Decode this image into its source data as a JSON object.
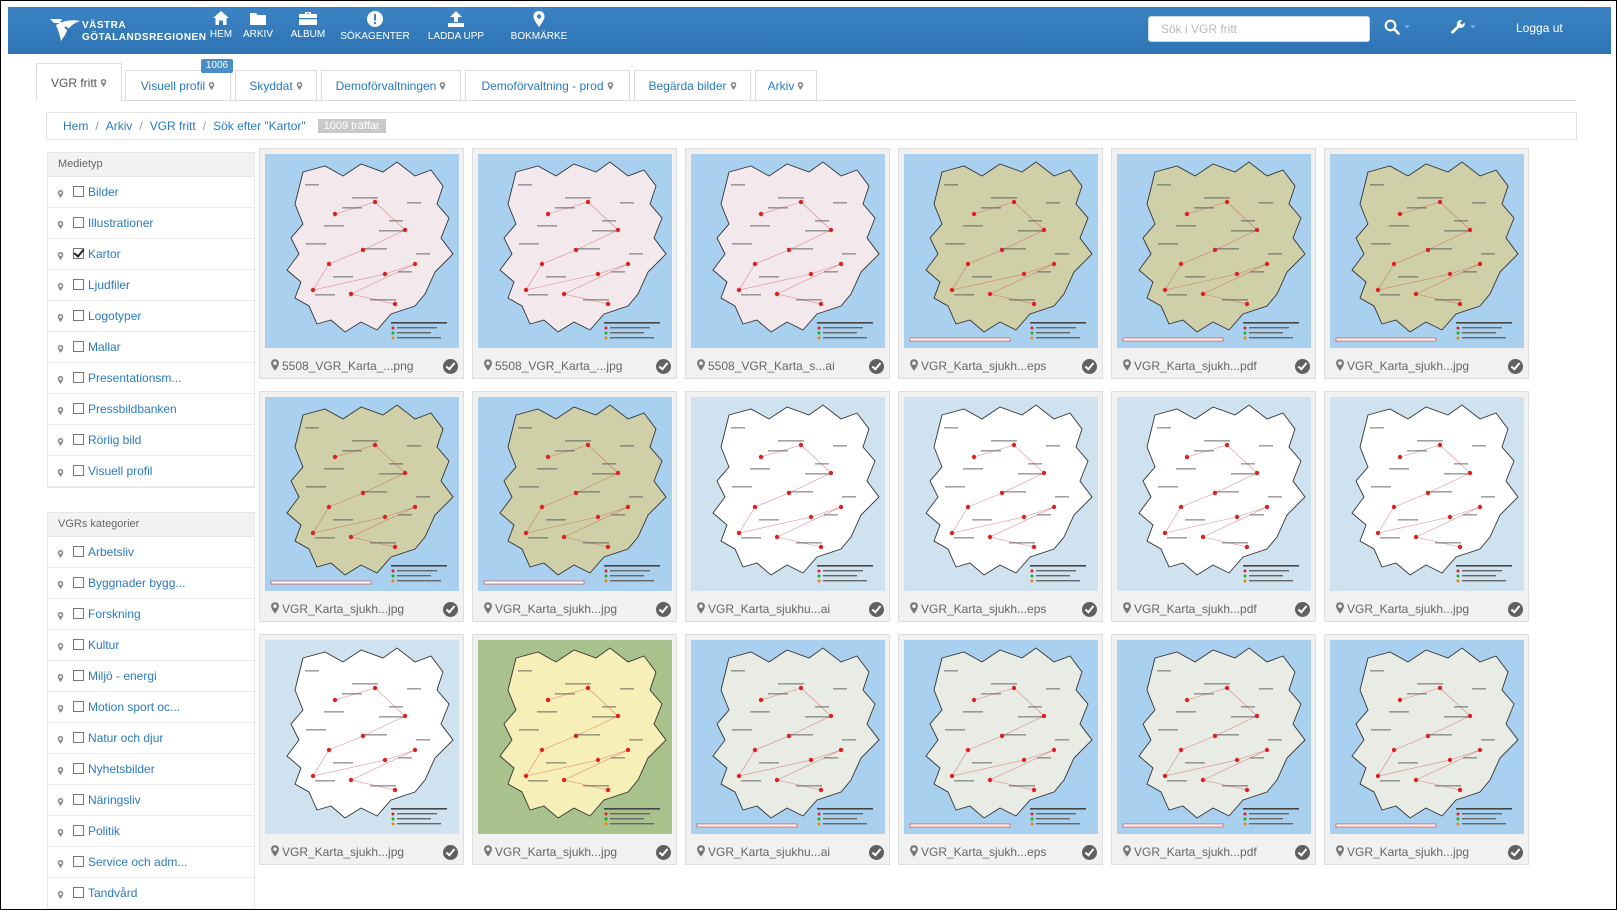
{
  "app": {
    "logo_line1": "VÄSTRA",
    "logo_line2": "GÖTALANDSREGIONEN"
  },
  "nav": [
    {
      "label": "HEM",
      "icon": "home-icon"
    },
    {
      "label": "ARKIV",
      "icon": "folder-icon"
    },
    {
      "label": "ALBUM",
      "icon": "briefcase-icon"
    },
    {
      "label": "SÖKAGENTER",
      "icon": "alert-icon"
    },
    {
      "label": "LADDA UPP",
      "icon": "upload-icon"
    },
    {
      "label": "BOKMÄRKE",
      "icon": "map-pin-icon"
    }
  ],
  "header": {
    "search_placeholder": "Sök i VGR fritt",
    "logout": "Logga ut"
  },
  "tabs": [
    {
      "label": "VGR fritt",
      "active": true
    },
    {
      "label": "Visuell profil"
    },
    {
      "label": "Skyddat"
    },
    {
      "label": "Demoförvaltningen"
    },
    {
      "label": "Demoförvaltning - prod"
    },
    {
      "label": "Begärda bilder"
    },
    {
      "label": "Arkiv"
    }
  ],
  "tab_badge": "1006",
  "breadcrumb": {
    "items": [
      "Hem",
      "Arkiv",
      "VGR fritt",
      "Sök efter \"Kartor\""
    ],
    "hits": "1009 träffar"
  },
  "facets": [
    {
      "title": "Medietyp",
      "items": [
        {
          "label": "Bilder",
          "checked": false
        },
        {
          "label": "Illustrationer",
          "checked": false
        },
        {
          "label": "Kartor",
          "checked": true
        },
        {
          "label": "Ljudfiler",
          "checked": false
        },
        {
          "label": "Logotyper",
          "checked": false
        },
        {
          "label": "Mallar",
          "checked": false
        },
        {
          "label": "Presentationsm...",
          "checked": false
        },
        {
          "label": "Pressbildbanken",
          "checked": false
        },
        {
          "label": "Rörlig bild",
          "checked": false
        },
        {
          "label": "Visuell profil",
          "checked": false
        }
      ]
    },
    {
      "title": "VGRs kategorier",
      "items": [
        {
          "label": "Arbetsliv",
          "checked": false
        },
        {
          "label": "Byggnader bygg...",
          "checked": false
        },
        {
          "label": "Forskning",
          "checked": false
        },
        {
          "label": "Kultur",
          "checked": false
        },
        {
          "label": "Miljö - energi",
          "checked": false
        },
        {
          "label": "Motion sport oc...",
          "checked": false
        },
        {
          "label": "Natur och djur",
          "checked": false
        },
        {
          "label": "Nyhetsbilder",
          "checked": false
        },
        {
          "label": "Näringsliv",
          "checked": false
        },
        {
          "label": "Politik",
          "checked": false
        },
        {
          "label": "Service och adm...",
          "checked": false
        },
        {
          "label": "Tandvård",
          "checked": false
        }
      ]
    }
  ],
  "results": [
    {
      "name": "5508_VGR_Karta_...png",
      "style": "pink"
    },
    {
      "name": "5508_VGR_Karta_...jpg",
      "style": "pink"
    },
    {
      "name": "5508_VGR_Karta_s...ai",
      "style": "pink"
    },
    {
      "name": "VGR_Karta_sjukh...eps",
      "style": "olive"
    },
    {
      "name": "VGR_Karta_sjukh...pdf",
      "style": "olive"
    },
    {
      "name": "VGR_Karta_sjukh...jpg",
      "style": "olive"
    },
    {
      "name": "VGR_Karta_sjukh...jpg",
      "style": "olive"
    },
    {
      "name": "VGR_Karta_sjukh...jpg",
      "style": "olive"
    },
    {
      "name": "VGR_Karta_sjukhu...ai",
      "style": "white"
    },
    {
      "name": "VGR_Karta_sjukh...eps",
      "style": "white"
    },
    {
      "name": "VGR_Karta_sjukh...pdf",
      "style": "white"
    },
    {
      "name": "VGR_Karta_sjukh...jpg",
      "style": "white"
    },
    {
      "name": "VGR_Karta_sjukh...jpg",
      "style": "white"
    },
    {
      "name": "VGR_Karta_sjukh...jpg",
      "style": "yellow"
    },
    {
      "name": "VGR_Karta_sjukhu...ai",
      "style": "gray"
    },
    {
      "name": "VGR_Karta_sjukh...eps",
      "style": "gray"
    },
    {
      "name": "VGR_Karta_sjukh...pdf",
      "style": "gray"
    },
    {
      "name": "VGR_Karta_sjukh...jpg",
      "style": "gray"
    }
  ],
  "colors": {
    "header": "#3b83c3",
    "link": "#2a7ac1",
    "sea": "#a9d0ef",
    "land_pink": "#f3e9ec",
    "land_olive": "#cfcfa8",
    "land_white": "#ffffff",
    "land_yellow": "#f7efb8",
    "land_gray": "#e9ebe5",
    "frame_green": "#a9c18d"
  }
}
